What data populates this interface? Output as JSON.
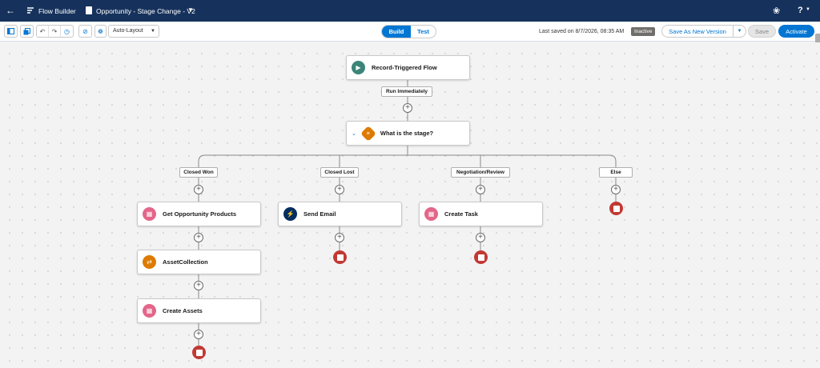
{
  "topbar": {
    "app_name": "Flow Builder",
    "flow_title": "Opportunity - Stage Change - V2"
  },
  "toolbar": {
    "layout_mode": "Auto-Layout",
    "build_label": "Build",
    "test_label": "Test",
    "last_saved": "Last saved on 8/7/2026, 08:35 AM",
    "status": "Inactive",
    "save_as_label": "Save As New Version",
    "save_label": "Save",
    "activate_label": "Activate"
  },
  "colors": {
    "header_bg": "#16325c",
    "brand_blue": "#0176d3",
    "trigger_green": "#3b8579",
    "decision_orange": "#dd7a01",
    "record_pink": "#e3668a",
    "action_navy": "#032d60",
    "end_red": "#c23934"
  },
  "flow": {
    "trigger": {
      "label": "Record-Triggered Flow",
      "icon": "play-icon"
    },
    "run_label": "Run Immediately",
    "decision": {
      "label": "What is the stage?",
      "icon": "decision-icon"
    },
    "branches": [
      {
        "label": "Closed Won"
      },
      {
        "label": "Closed Lost"
      },
      {
        "label": "Negotiation/Review"
      },
      {
        "label": "Else"
      }
    ],
    "elements": {
      "get_products": {
        "label": "Get Opportunity Products",
        "icon": "record-lookup-icon"
      },
      "asset_collection": {
        "label": "AssetCollection",
        "icon": "assignment-icon"
      },
      "create_assets": {
        "label": "Create Assets",
        "icon": "record-create-icon"
      },
      "send_email": {
        "label": "Send Email",
        "icon": "lightning-action-icon"
      },
      "create_task": {
        "label": "Create Task",
        "icon": "record-create-icon"
      }
    }
  }
}
